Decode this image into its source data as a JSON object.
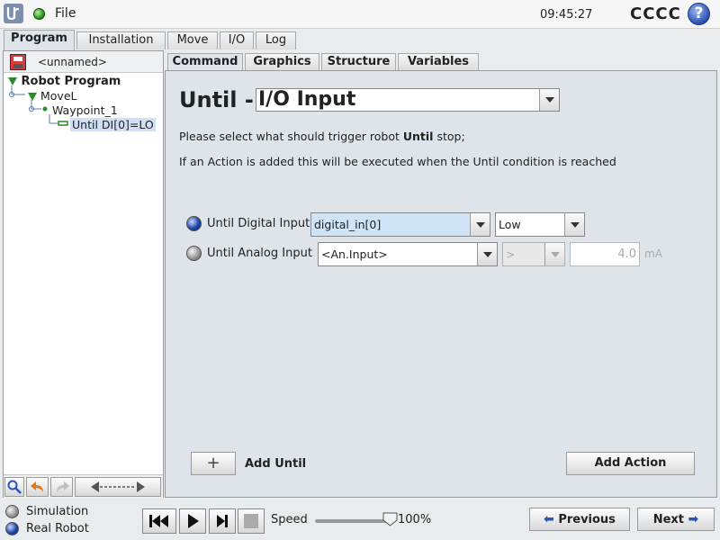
{
  "topbar": {
    "file_label": "File",
    "clock": "09:45:27",
    "robot_name": "CCCC",
    "help_label": "?"
  },
  "main_tabs": [
    "Program",
    "Installation",
    "Move",
    "I/O",
    "Log"
  ],
  "left_panel": {
    "program_name": "<unnamed>",
    "tree": [
      {
        "label": "Robot Program"
      },
      {
        "label": "MoveL"
      },
      {
        "label": "Waypoint_1"
      },
      {
        "label": "Until DI[0]=LO"
      }
    ]
  },
  "sub_tabs": [
    "Command",
    "Graphics",
    "Structure",
    "Variables"
  ],
  "command": {
    "title_prefix": "Until -",
    "title_select": "I/O Input",
    "desc_1_before": "Please select what should trigger robot ",
    "desc_1_bold": "Until",
    "desc_1_after": " stop;",
    "desc_2": "If an Action is added this will be executed when the Until condition is reached",
    "digital": {
      "label": "Until Digital Input",
      "input": "digital_in[0]",
      "level": "Low"
    },
    "analog": {
      "label": "Until Analog Input",
      "input": "<An.Input>",
      "operator": ">",
      "value": "4.0",
      "unit": "mA"
    },
    "add_until": "Add Until",
    "add_action": "Add Action",
    "plus_symbol": "+"
  },
  "bottom": {
    "simulation": "Simulation",
    "real_robot": "Real Robot",
    "speed_label": "Speed",
    "speed_value": "100%",
    "previous": "Previous",
    "next": "Next"
  },
  "colors": {
    "panel_bg": "#dfe4ea",
    "selection": "#cfe4f7",
    "accent_blue": "#2a55b8",
    "status_green": "#2f9a1f"
  }
}
